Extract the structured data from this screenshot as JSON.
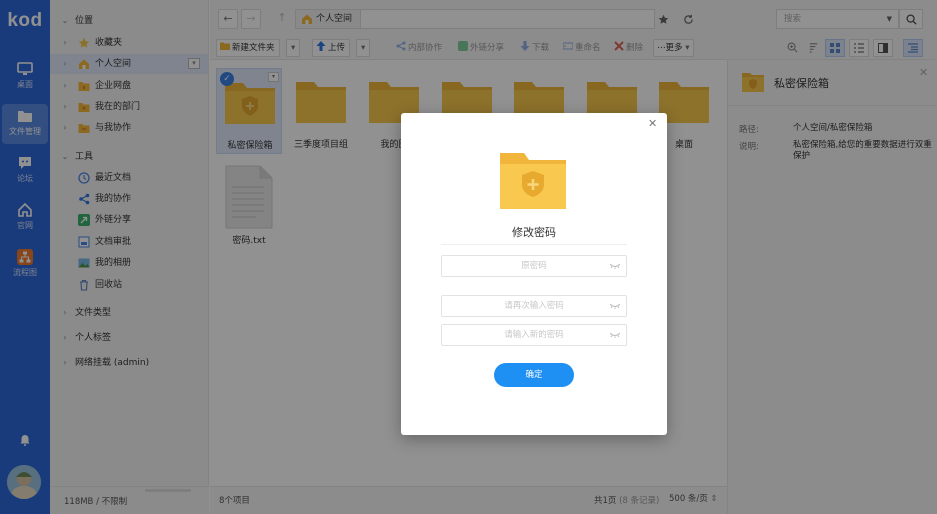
{
  "app": {
    "logo": "kod",
    "nav": [
      {
        "label": "桌面",
        "icon": "desktop-icon"
      },
      {
        "label": "文件管理",
        "icon": "folder-manage-icon",
        "active": true
      },
      {
        "label": "论坛",
        "icon": "forum-icon"
      },
      {
        "label": "官网",
        "icon": "home-icon"
      },
      {
        "label": "流程图",
        "icon": "flowchart-icon"
      }
    ]
  },
  "tree": {
    "location_label": "位置",
    "location_items": [
      {
        "label": "收藏夹",
        "icon": "star-icon"
      },
      {
        "label": "个人空间",
        "icon": "home-folder-icon",
        "selected": true
      },
      {
        "label": "企业网盘",
        "icon": "folder-icon"
      },
      {
        "label": "我在的部门",
        "icon": "folder-icon"
      },
      {
        "label": "与我协作",
        "icon": "folder-icon"
      }
    ],
    "tools_label": "工具",
    "tools_items": [
      {
        "label": "最近文档",
        "icon": "clock-icon"
      },
      {
        "label": "我的协作",
        "icon": "share-network-icon"
      },
      {
        "label": "外链分享",
        "icon": "external-share-icon"
      },
      {
        "label": "文档审批",
        "icon": "approval-icon"
      },
      {
        "label": "我的相册",
        "icon": "album-icon"
      },
      {
        "label": "回收站",
        "icon": "trash-icon"
      }
    ],
    "file_types_label": "文件类型",
    "personal_tags_label": "个人标签",
    "network_mount_label": "网络挂载 (admin)",
    "quota": "118MB / 不限制"
  },
  "address": {
    "segment": "个人空间"
  },
  "search": {
    "placeholder": "搜索"
  },
  "toolbar": {
    "new_folder": "新建文件夹",
    "upload": "上传",
    "collab": "内部协作",
    "share": "外链分享",
    "download": "下载",
    "rename": "重命名",
    "delete": "删除",
    "more": "更多"
  },
  "files": [
    {
      "name": "私密保险箱",
      "type": "safe-folder",
      "selected": true
    },
    {
      "name": "三季度项目组",
      "type": "folder"
    },
    {
      "name": "我的图",
      "type": "folder"
    },
    {
      "name": "",
      "type": "folder"
    },
    {
      "name": "",
      "type": "folder"
    },
    {
      "name": "",
      "type": "folder"
    },
    {
      "name": "桌面",
      "type": "folder"
    },
    {
      "name": "密码.txt",
      "type": "text"
    }
  ],
  "status": {
    "count": "8个项目",
    "pages_a": "共1页",
    "pages_b": " (8 条记录)",
    "page_size": "500 条/页"
  },
  "panel": {
    "title": "私密保险箱",
    "path_label": "路径:",
    "path_value": "个人空间/私密保险箱",
    "desc_label": "说明:",
    "desc_value": "私密保险箱,给您的重要数据进行双重保护"
  },
  "dialog": {
    "title": "修改密码",
    "old_password_placeholder": "原密码",
    "confirm_password_placeholder": "请再次输入密码",
    "new_password_placeholder": "请输入新的密码",
    "ok": "确定"
  },
  "colors": {
    "appbar": "#2f68d8",
    "folder": "#f6c84f",
    "accent": "#1e8ff3"
  }
}
